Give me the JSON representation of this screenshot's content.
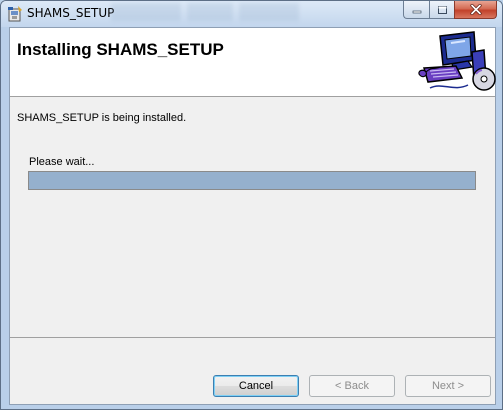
{
  "window": {
    "title": "SHAMS_SETUP",
    "icon": "installer-icon",
    "controls": [
      "minimize-icon",
      "maximize-icon",
      "close-icon"
    ]
  },
  "header": {
    "title": "Installing SHAMS_SETUP",
    "art": "computer-with-cd-illustration"
  },
  "body": {
    "status": "SHAMS_SETUP is being installed.",
    "wait_label": "Please wait...",
    "progress": 1.0
  },
  "buttons": {
    "cancel": "Cancel",
    "back": "< Back",
    "next": "Next >"
  },
  "colors": {
    "progress_fill": "#95b0cd",
    "close_button": "#c2412a"
  }
}
